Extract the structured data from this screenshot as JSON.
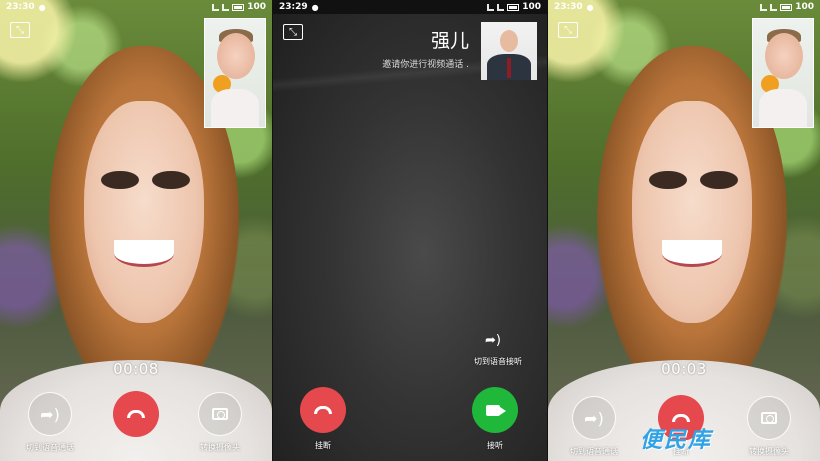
{
  "screens": {
    "left": {
      "status": {
        "time": "23:30",
        "battery": "100"
      },
      "timer": "00:08",
      "controls": {
        "voice_label": "切到语音通话",
        "camera_label": "转换摄像头"
      }
    },
    "middle": {
      "status": {
        "time": "23:29",
        "battery": "100"
      },
      "caller": {
        "name": "强儿",
        "message": "邀请你进行视频通话 ."
      },
      "switch_voice_label": "切到语音接听",
      "hangup_label": "挂断",
      "answer_label": "接听"
    },
    "right": {
      "status": {
        "time": "23:30",
        "battery": "100"
      },
      "timer": "00:03",
      "controls": {
        "voice_label": "切到语音通话",
        "hangup_label": "挂断",
        "camera_label": "转换摄像头"
      }
    }
  },
  "watermark": "便民库",
  "colors": {
    "hangup": "#e5484d",
    "answer": "#1fb83b",
    "watermark": "#2fa3e6"
  },
  "icons": [
    "minimize-icon",
    "voice-switch-icon",
    "hangup-icon",
    "camera-switch-icon",
    "video-answer-icon"
  ]
}
